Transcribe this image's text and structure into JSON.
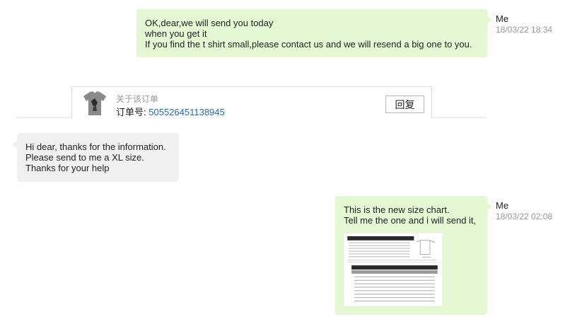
{
  "messages": [
    {
      "sender": "Me",
      "time": "18/03/22 18:34",
      "lines": [
        "OK,dear,we will send you today",
        "when you get it",
        "If you find the t shirt small,please contact us and we will resend a big one to you."
      ]
    },
    {
      "sender": "",
      "lines": [
        "Hi dear, thanks for the information.",
        "Please send to me a XL size.",
        "Thanks for your help"
      ]
    },
    {
      "sender": "Me",
      "time": "18/03/22 02:08",
      "lines": [
        "This is the new size chart.",
        "Tell me the one and i will send it,"
      ],
      "attachment_icon": "size-chart-image"
    }
  ],
  "order_card": {
    "title": "关于该订单",
    "number_label": "订单号:",
    "number": "505526451138945",
    "reply_label": "回复",
    "thumbnail_icon": "tshirt-icon"
  },
  "colors": {
    "my_bubble": "#e5f8d4",
    "their_bubble": "#f0f0f0",
    "link": "#2a6ab0",
    "timestamp": "#999999"
  }
}
